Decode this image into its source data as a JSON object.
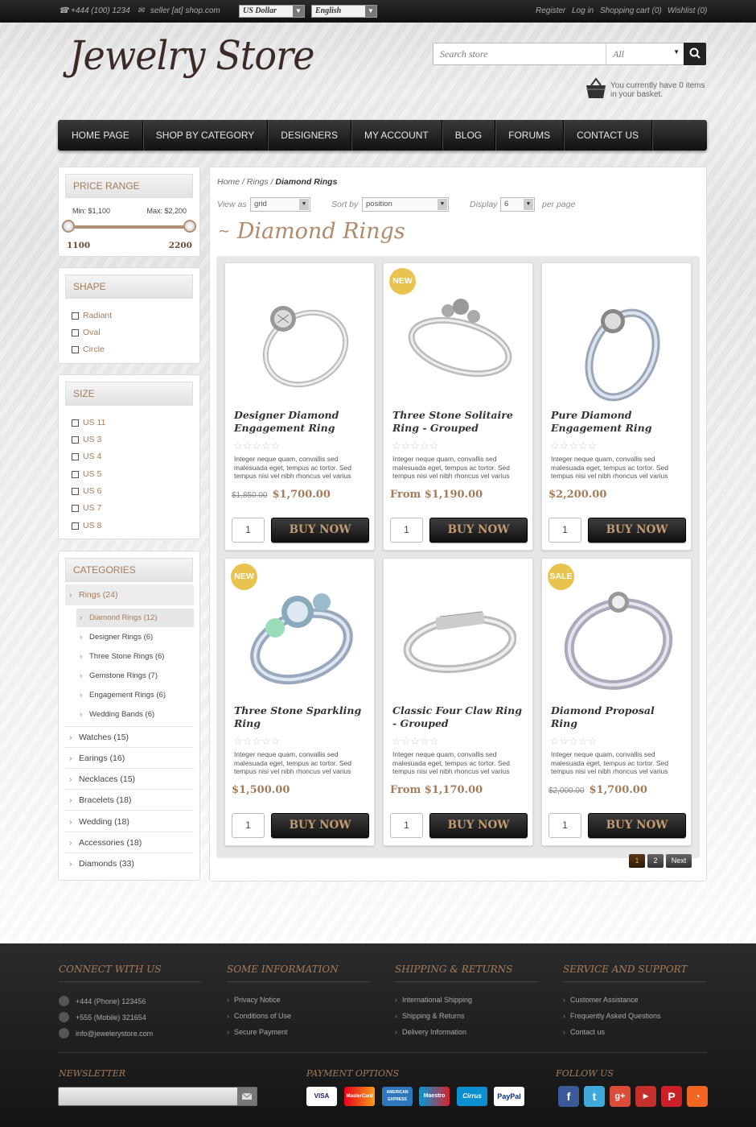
{
  "topbar": {
    "phone": "+444 (100) 1234",
    "email": "seller [at] shop.com",
    "currency": "US Dollar",
    "language": "English",
    "links": [
      "Register",
      "Log in",
      "Shopping cart (0)",
      "Wishlist (0)"
    ]
  },
  "header": {
    "logo": "Jewelry Store",
    "search_placeholder": "Search store",
    "search_category": "All",
    "basket_text": "You currently have 0 items in your basket."
  },
  "nav": [
    "HOME PAGE",
    "SHOP BY CATEGORY",
    "DESIGNERS",
    "MY ACCOUNT",
    "BLOG",
    "FORUMS",
    "CONTACT US"
  ],
  "sidebar": {
    "price": {
      "title": "PRICE RANGE",
      "min_label": "Min: $1,100",
      "max_label": "Max: $2,200",
      "min": "1100",
      "max": "2200"
    },
    "shape": {
      "title": "SHAPE",
      "items": [
        "Radiant",
        "Oval",
        "Circle"
      ]
    },
    "size": {
      "title": "SIZE",
      "items": [
        "US 11",
        "US 3",
        "US 4",
        "US 5",
        "US 6",
        "US 7",
        "US 8"
      ]
    },
    "categories": {
      "title": "CATEGORIES",
      "active": "Rings (24)",
      "subs": [
        "Diamond Rings (12)",
        "Designer Rings (6)",
        "Three Stone Rings (6)",
        "Gemstone Rings (7)",
        "Engagement Rings (6)",
        "Wedding Bands (6)"
      ],
      "items": [
        "Watches (15)",
        "Earings (16)",
        "Necklaces (15)",
        "Bracelets (18)",
        "Wedding (18)",
        "Accessories (18)",
        "Diamonds (33)"
      ]
    }
  },
  "main": {
    "breadcrumb": {
      "home": "Home",
      "sep": "/",
      "rings": "Rings",
      "current": "Diamond Rings"
    },
    "toolbar": {
      "view_as": "View as",
      "view_val": "grid",
      "sort_by": "Sort by",
      "sort_val": "position",
      "display": "Display",
      "display_val": "6",
      "per_page": "per page"
    },
    "title": "Diamond Rings",
    "products": [
      {
        "name": "Designer Diamond Engagement Ring",
        "old_price": "$1,850.00",
        "price": "$1,700.00",
        "badge": ""
      },
      {
        "name": "Three Stone Solitaire Ring - Grouped",
        "old_price": "",
        "price": "From $1,190.00",
        "badge": "NEW"
      },
      {
        "name": "Pure Diamond Engagement Ring",
        "old_price": "",
        "price": "$2,200.00",
        "badge": ""
      },
      {
        "name": "Three Stone Sparkling Ring",
        "old_price": "",
        "price": "$1,500.00",
        "badge": "NEW"
      },
      {
        "name": "Classic Four Claw Ring - Grouped",
        "old_price": "",
        "price": "From $1,170.00",
        "badge": ""
      },
      {
        "name": "Diamond Proposal Ring",
        "old_price": "$2,000.00",
        "price": "$1,700.00",
        "badge": "SALE"
      }
    ],
    "description": "Integer neque quam, convallis sed malesuada eget, tempus ac tortor. Sed tempus nisi vel nibh rhoncus vel varius",
    "qty": "1",
    "buy_label": "BUY NOW",
    "pager": [
      "1",
      "2",
      "Next"
    ]
  },
  "footer": {
    "connect": {
      "title": "CONNECT WITH US",
      "items": [
        "+444 (Phone) 123456",
        "+555 (Mobile) 321654",
        "info@jewelerystore.com"
      ]
    },
    "info": {
      "title": "SOME INFORMATION",
      "items": [
        "Privacy Notice",
        "Conditions of Use",
        "Secure Payment"
      ]
    },
    "shipping": {
      "title": "SHIPPING & RETURNS",
      "items": [
        "International Shipping",
        "Shipping & Returns",
        "Delivery Information"
      ]
    },
    "service": {
      "title": "SERVICE AND SUPPORT",
      "items": [
        "Customer Assistance",
        "Frequently Asked Questions",
        "Contact us"
      ]
    },
    "newsletter": "NEWSLETTER",
    "payment": {
      "title": "PAYMENT OPTIONS",
      "cards": [
        "VISA",
        "MasterCard",
        "AMERICAN EXPRESS",
        "Maestro",
        "Cirrus",
        "PayPal"
      ]
    },
    "follow": {
      "title": "FOLLOW US",
      "icons": [
        "facebook-icon",
        "twitter-icon",
        "google-plus-icon",
        "youtube-icon",
        "pinterest-icon",
        "rss-icon"
      ]
    }
  }
}
